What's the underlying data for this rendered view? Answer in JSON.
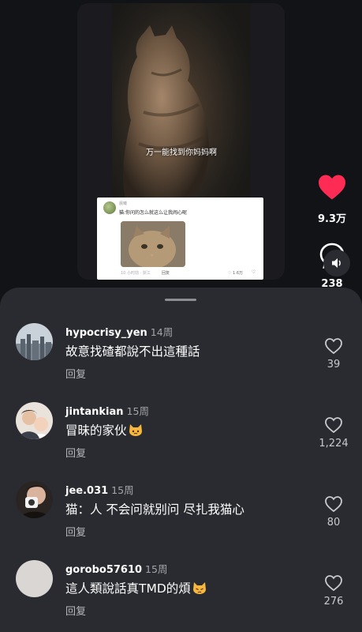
{
  "video": {
    "subtitle": "万一能找到你妈妈啊",
    "embedded_comment": {
      "username": "晨曦",
      "text": "猫:你问的怎么就这么让我闹心呢",
      "meta": "10 小时前 · 浙江",
      "reply_label": "回复",
      "like_count": "1.6万"
    }
  },
  "actions": {
    "like_count": "9.3万",
    "comment_count": "238",
    "colors": {
      "like": "#fe2c55"
    }
  },
  "comments": [
    {
      "username": "hypocrisy_yen",
      "time": "14周",
      "text": "故意找碴都說不出這種話",
      "emoji": "",
      "reply_label": "回复",
      "likes": "39",
      "avatar": "city-skyline-avatar"
    },
    {
      "username": "jintankian",
      "time": "15周",
      "text": "冒昧的家伙",
      "emoji": "cat-face-emoji",
      "reply_label": "回复",
      "likes": "1,224",
      "avatar": "family-photo-avatar"
    },
    {
      "username": "jee.031",
      "time": "15周",
      "text": "猫：人 不会问就别问 尽扎我猫心",
      "emoji": "",
      "reply_label": "回复",
      "likes": "80",
      "avatar": "camera-person-avatar"
    },
    {
      "username": "gorobo57610",
      "time": "15周",
      "text": "這人類說話真TMD的煩",
      "emoji": "cat-face-emoji",
      "reply_label": "回复",
      "likes": "276",
      "avatar": "blank-avatar"
    }
  ]
}
